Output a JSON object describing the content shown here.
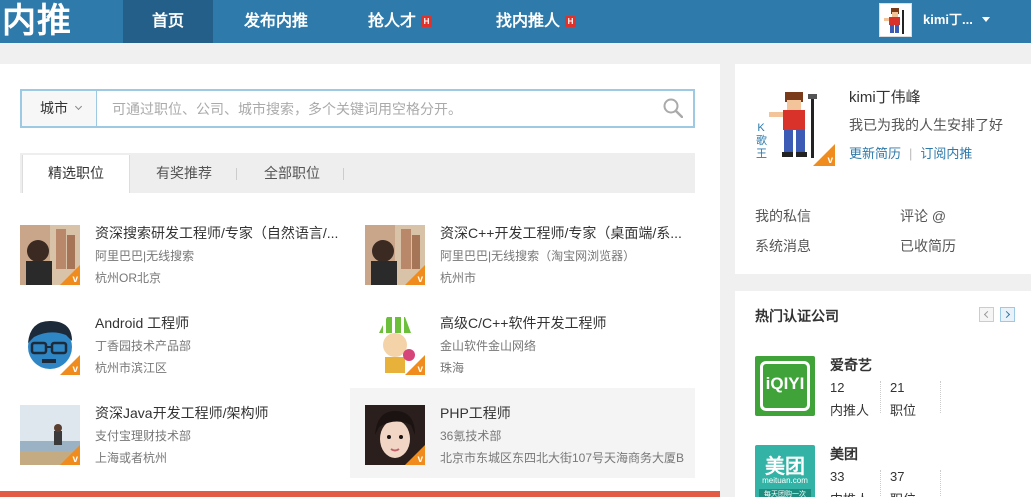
{
  "header": {
    "logo": "内推",
    "nav": [
      {
        "label": "首页",
        "badge": ""
      },
      {
        "label": "发布内推",
        "badge": ""
      },
      {
        "label": "抢人才",
        "badge": "H"
      },
      {
        "label": "找内推人",
        "badge": "H"
      }
    ],
    "user_name": "kimi丁..."
  },
  "search": {
    "city_label": "城市",
    "placeholder": "可通过职位、公司、城市搜索，多个关键词用空格分开。"
  },
  "tabs": [
    "精选职位",
    "有奖推荐",
    "全部职位"
  ],
  "jobs": [
    {
      "title": "资深搜索研发工程师/专家（自然语言/...",
      "company": "阿里巴巴|无线搜索",
      "location": "杭州OR北京",
      "badge": "v"
    },
    {
      "title": "资深C++开发工程师/专家（桌面端/系...",
      "company": "阿里巴巴|无线搜索（淘宝网浏览器）",
      "location": "杭州市",
      "badge": "v"
    },
    {
      "title": "Android 工程师",
      "company": "丁香园技术产品部",
      "location": "杭州市滨江区",
      "badge": "v"
    },
    {
      "title": "高级C/C++软件开发工程师",
      "company": "金山软件金山网络",
      "location": "珠海",
      "badge": "v"
    },
    {
      "title": "资深Java开发工程师/架构师",
      "company": "支付宝理财技术部",
      "location": "上海或者杭州",
      "badge": "v"
    },
    {
      "title": "PHP工程师",
      "company": "36氪技术部",
      "location": "北京市东城区东四北大街107号天海商务大厦B",
      "badge": "v"
    }
  ],
  "profile": {
    "name": "kimi丁伟峰",
    "motto": "我已为我的人生安排了好",
    "avatar_caption": "K 歌 王",
    "link_resume": "更新简历",
    "link_subscribe": "订阅内推",
    "links": [
      "我的私信",
      "评论 @",
      "系统消息",
      "已收简历"
    ],
    "badge": "v"
  },
  "hot_companies": {
    "title": "热门认证公司",
    "companies": [
      {
        "name": "爱奇艺",
        "logo_text": "iQIYI",
        "referrers": "12",
        "referrers_label": "内推人",
        "jobs": "21",
        "jobs_label": "职位",
        "color": "#3fa33a"
      },
      {
        "name": "美团",
        "logo_text": "美团",
        "logo_sub": "meituan.com",
        "logo_slogan": "每天团购一次",
        "referrers": "33",
        "referrers_label": "内推人",
        "jobs": "37",
        "jobs_label": "职位",
        "color": "#32b3a5"
      }
    ]
  },
  "colors": {
    "nav_bg": "#2e7aab",
    "nav_active": "#235f88",
    "badge_orange": "#f08c1e",
    "hot_badge": "#e0322b",
    "link_blue": "#2e7aab",
    "bottom_bar": "#e35b45"
  }
}
